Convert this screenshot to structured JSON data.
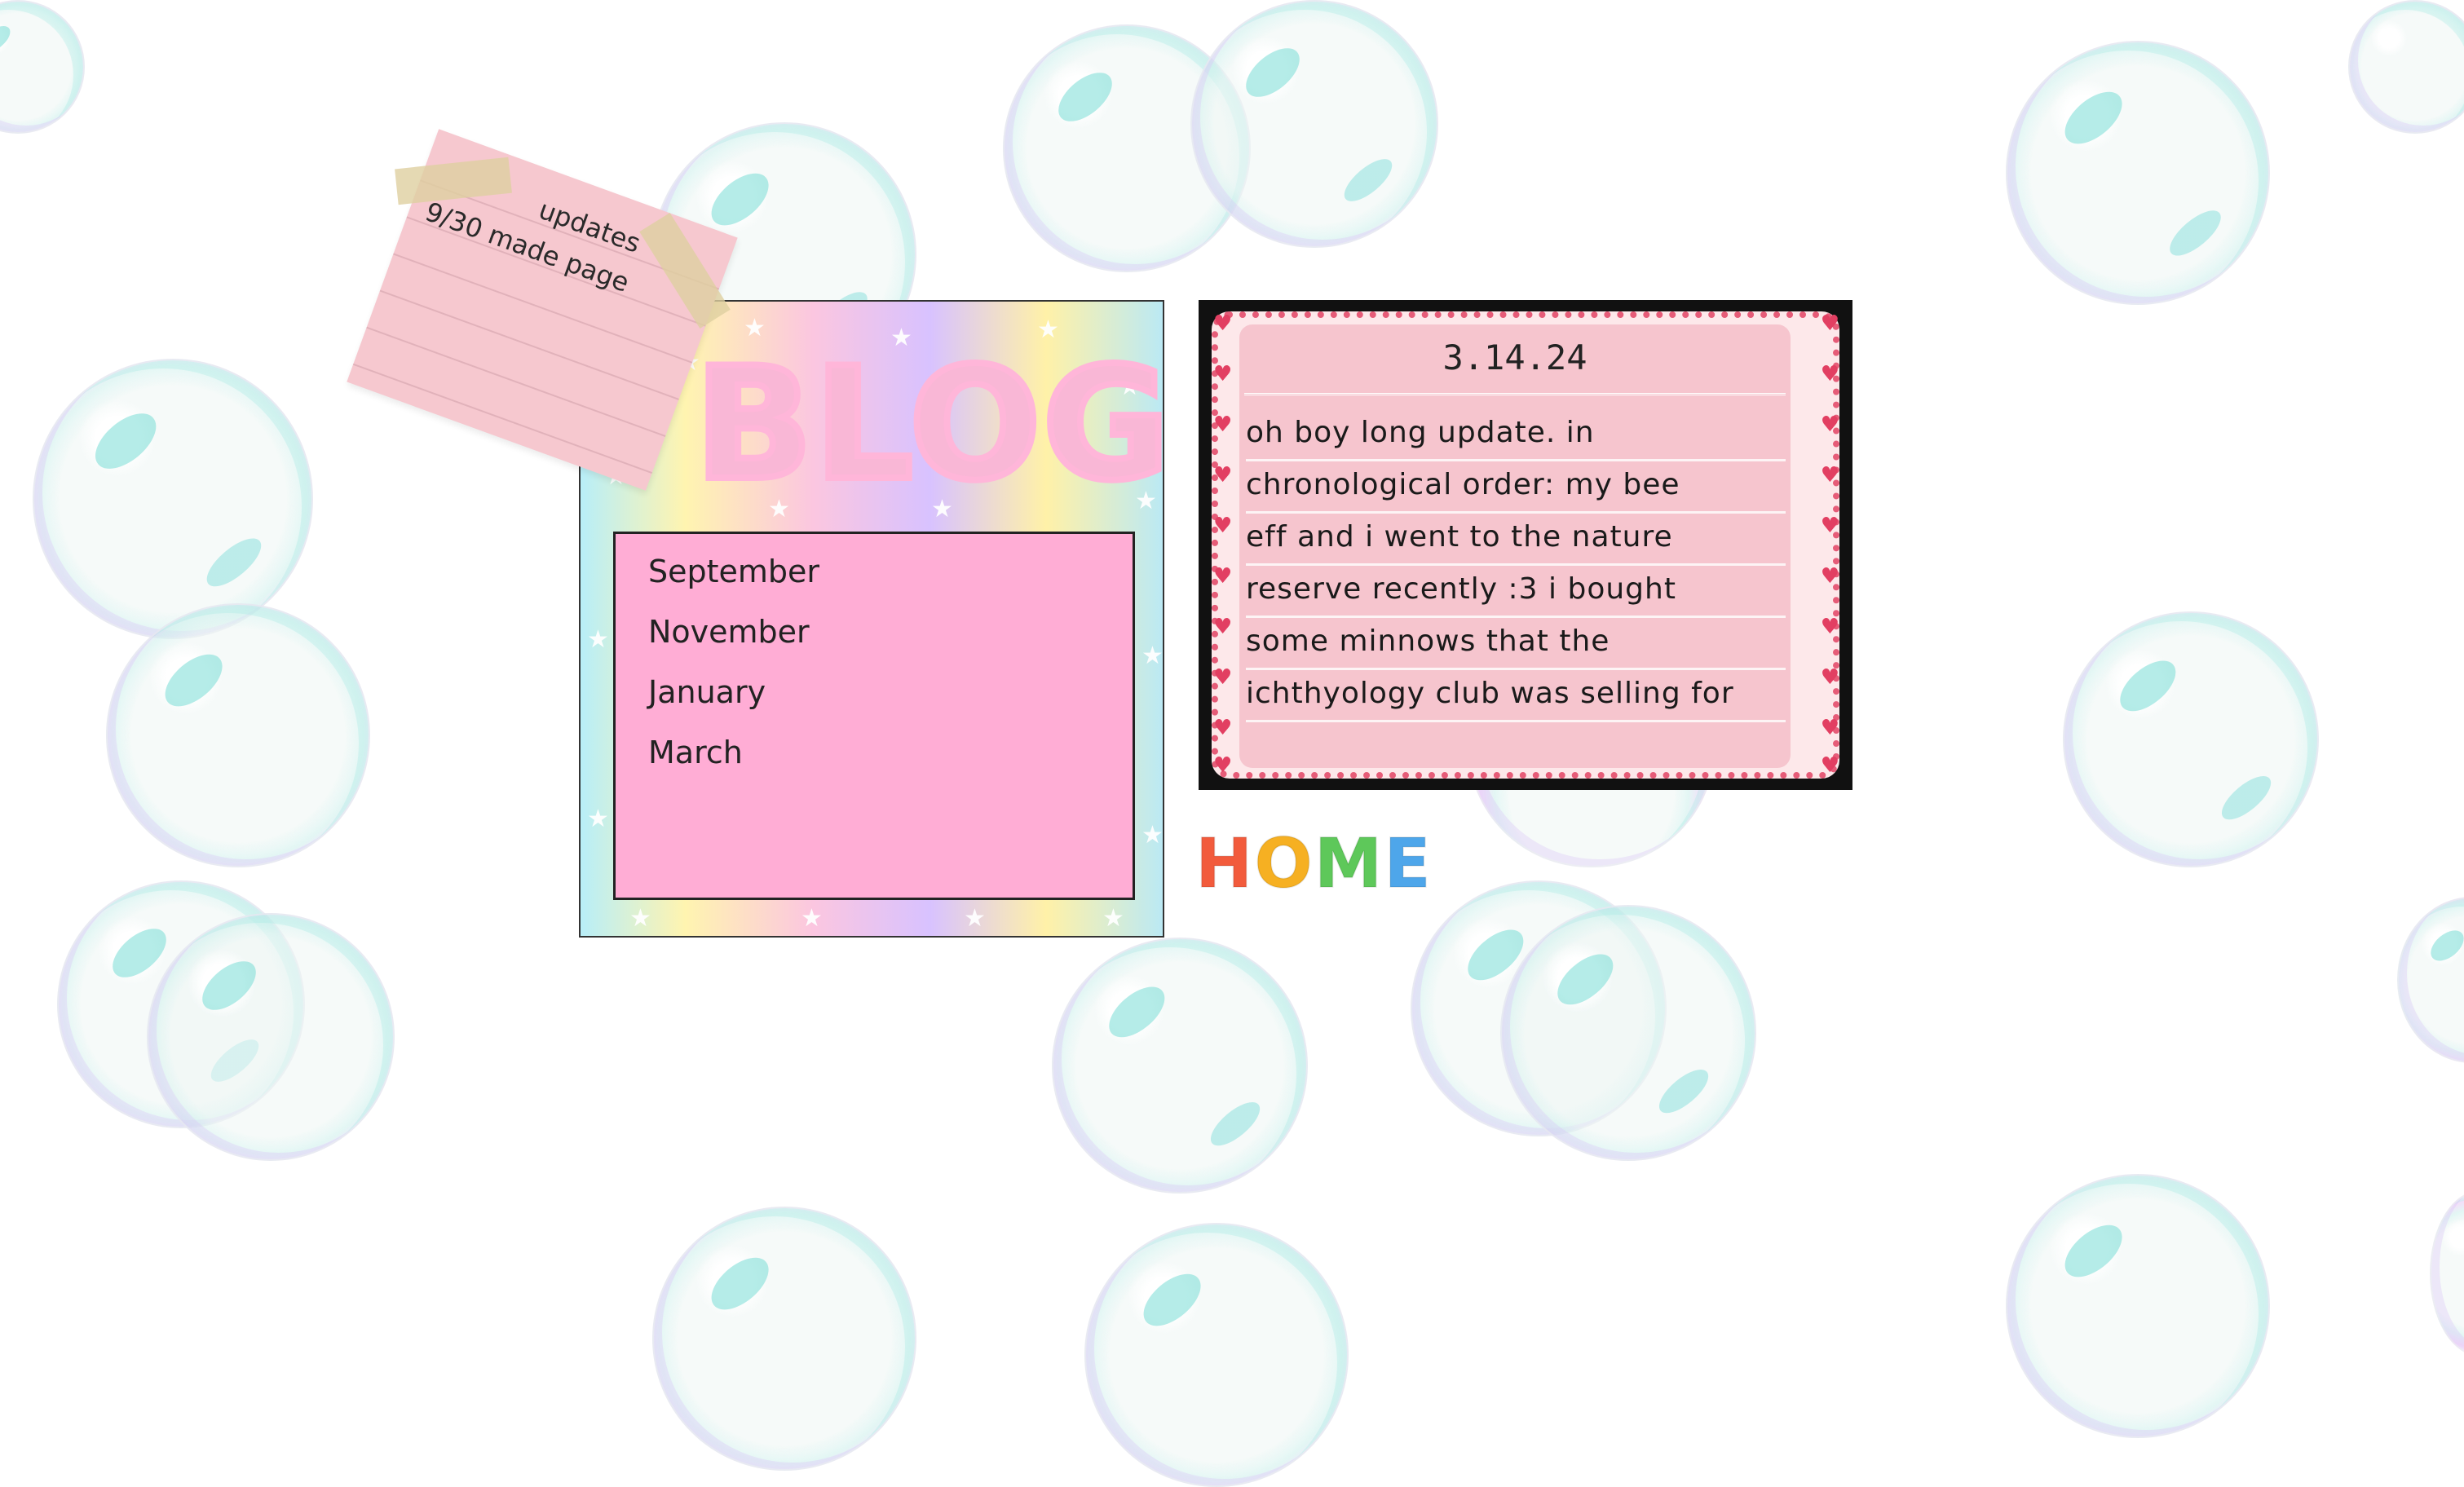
{
  "note": {
    "title": "updates",
    "entry": "9/30 made page"
  },
  "blog": {
    "title": "BLOG",
    "months": [
      "September",
      "November",
      "January",
      "March"
    ]
  },
  "post": {
    "date": "3.14.24",
    "lines": [
      "oh boy long update. in",
      "chronological order: my bee",
      "eff and i went to the nature",
      "reserve recently :3 i bought",
      "some minnows that the",
      "ichthyology club was selling for"
    ]
  },
  "home": {
    "label": "HOME",
    "letter_colors": [
      "#f25b3c",
      "#f6b022",
      "#5ec85a",
      "#4ea6ea",
      "#b07af0"
    ]
  },
  "colors": {
    "blog_list_bg": "#ffadd5",
    "post_bg": "#f6c5ce",
    "heart": "#e23f62",
    "note_bg": "#f6c8cf"
  }
}
